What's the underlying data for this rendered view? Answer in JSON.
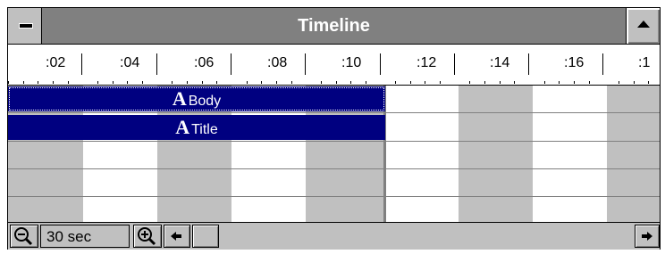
{
  "window": {
    "title": "Timeline"
  },
  "titlebar": {
    "system_menu_icon": "minus-icon",
    "maximize_icon": "up-triangle-icon"
  },
  "ruler": {
    "labels": [
      ":02",
      ":04",
      ":06",
      ":08",
      ":10",
      ":12",
      ":14",
      ":16",
      ":1"
    ]
  },
  "tracks": [
    {
      "letter": "A",
      "label": "Body",
      "selected": true,
      "color": "#000080"
    },
    {
      "letter": "A",
      "label": "Title",
      "selected": false,
      "color": "#000080"
    }
  ],
  "bottom": {
    "zoom_out_icon": "zoom-out-icon",
    "zoom_value": "30 sec",
    "zoom_in_icon": "zoom-in-icon",
    "scroll_left_icon": "left-arrow-icon",
    "scroll_right_icon": "right-arrow-icon"
  },
  "colors": {
    "selection": "#000080",
    "chrome": "#c0c0c0",
    "titlebar": "#808080"
  }
}
